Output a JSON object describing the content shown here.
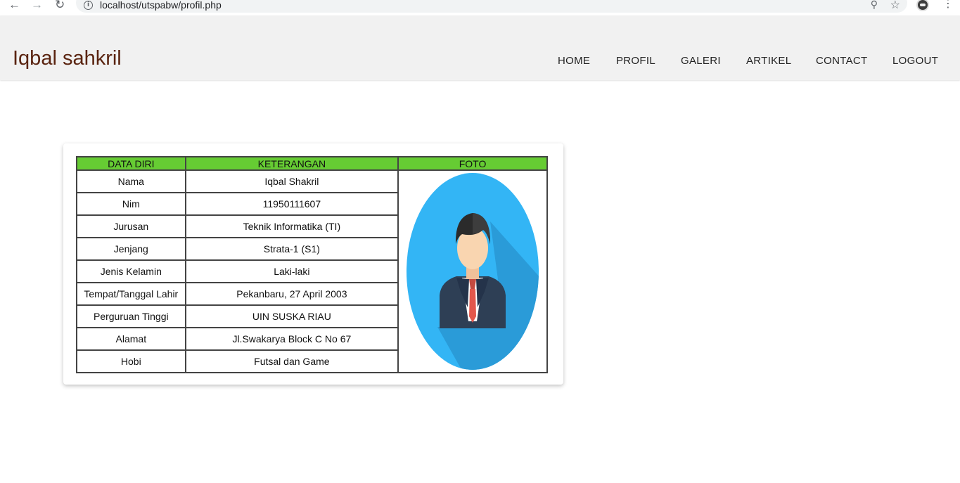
{
  "browser": {
    "url": "localhost/utspabw/profil.php"
  },
  "header": {
    "site_title": "Iqbal sahkril",
    "nav": [
      "HOME",
      "PROFIL",
      "GALERI",
      "ARTIKEL",
      "CONTACT",
      "LOGOUT"
    ]
  },
  "table": {
    "headers": [
      "DATA DIRI",
      "KETERANGAN",
      "FOTO"
    ],
    "rows": [
      {
        "label": "Nama",
        "value": "Iqbal Shakril"
      },
      {
        "label": "Nim",
        "value": "11950111607"
      },
      {
        "label": "Jurusan",
        "value": "Teknik Informatika (TI)"
      },
      {
        "label": "Jenjang",
        "value": "Strata-1 (S1)"
      },
      {
        "label": "Jenis Kelamin",
        "value": "Laki-laki"
      },
      {
        "label": "Tempat/Tanggal Lahir",
        "value": "Pekanbaru, 27 April 2003"
      },
      {
        "label": "Perguruan Tinggi",
        "value": "UIN SUSKA RIAU"
      },
      {
        "label": "Alamat",
        "value": "Jl.Swakarya Block C No 67"
      },
      {
        "label": "Hobi",
        "value": "Futsal dan Game"
      }
    ],
    "photo_icon": "businessman-avatar-icon",
    "header_color": "#66cc33"
  },
  "colors": {
    "title": "#5a2410",
    "header_bg": "#f1f1f1",
    "avatar_bg": "#33b5f5"
  }
}
